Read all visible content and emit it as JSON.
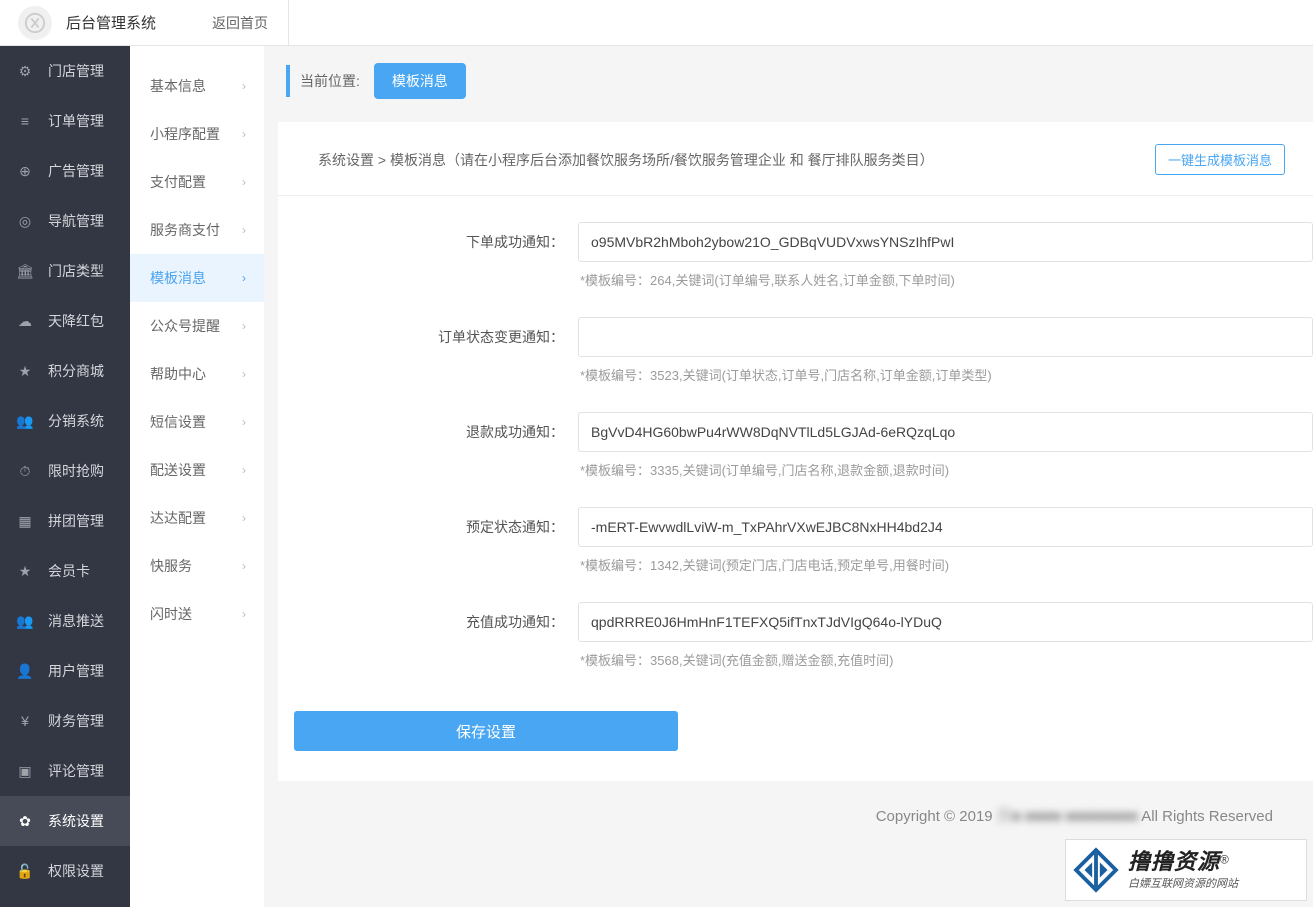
{
  "header": {
    "system_title": "后台管理系统",
    "back_home": "返回首页"
  },
  "primary_nav": [
    {
      "label": "门店管理",
      "icon": "dashboard"
    },
    {
      "label": "订单管理",
      "icon": "list"
    },
    {
      "label": "广告管理",
      "icon": "globe"
    },
    {
      "label": "导航管理",
      "icon": "target"
    },
    {
      "label": "门店类型",
      "icon": "bank"
    },
    {
      "label": "天降红包",
      "icon": "cloud"
    },
    {
      "label": "积分商城",
      "icon": "star"
    },
    {
      "label": "分销系统",
      "icon": "users"
    },
    {
      "label": "限时抢购",
      "icon": "clock"
    },
    {
      "label": "拼团管理",
      "icon": "grid"
    },
    {
      "label": "会员卡",
      "icon": "star"
    },
    {
      "label": "消息推送",
      "icon": "users"
    },
    {
      "label": "用户管理",
      "icon": "user"
    },
    {
      "label": "财务管理",
      "icon": "yen"
    },
    {
      "label": "评论管理",
      "icon": "comment"
    },
    {
      "label": "系统设置",
      "icon": "gear",
      "active": true
    },
    {
      "label": "权限设置",
      "icon": "lock"
    }
  ],
  "secondary_nav": [
    {
      "label": "基本信息"
    },
    {
      "label": "小程序配置"
    },
    {
      "label": "支付配置"
    },
    {
      "label": "服务商支付"
    },
    {
      "label": "模板消息",
      "active": true
    },
    {
      "label": "公众号提醒"
    },
    {
      "label": "帮助中心"
    },
    {
      "label": "短信设置"
    },
    {
      "label": "配送设置"
    },
    {
      "label": "达达配置"
    },
    {
      "label": "快服务"
    },
    {
      "label": "闪时送"
    }
  ],
  "breadcrumb": {
    "label": "当前位置:",
    "badge": "模板消息"
  },
  "panel": {
    "path": "系统设置 > 模板消息（请在小程序后台添加餐饮服务场所/餐饮服务管理企业 和 餐厅排队服务类目）",
    "generate_button": "一键生成模板消息"
  },
  "form": {
    "rows": [
      {
        "label": "下单成功通知：",
        "value": "o95MVbR2hMboh2ybow21O_GDBqVUDVxwsYNSzIhfPwI",
        "hint": "*模板编号：264,关键词(订单编号,联系人姓名,订单金额,下单时间)"
      },
      {
        "label": "订单状态变更通知：",
        "value": "",
        "hint": "*模板编号：3523,关键词(订单状态,订单号,门店名称,订单金额,订单类型)"
      },
      {
        "label": "退款成功通知：",
        "value": "BgVvD4HG60bwPu4rWW8DqNVTlLd5LGJAd-6eRQzqLqo",
        "hint": "*模板编号：3335,关键词(订单编号,门店名称,退款金额,退款时间)"
      },
      {
        "label": "预定状态通知：",
        "value": "-mERT-EwvwdlLviW-m_TxPAhrVXwEJBC8NxHH4bd2J4",
        "hint": "*模板编号：1342,关键词(预定门店,门店电话,预定单号,用餐时间)"
      },
      {
        "label": "充值成功通知：",
        "value": "qpdRRRE0J6HmHnF1TEFXQ5ifTnxTJdVIgQ64o-lYDuQ",
        "hint": "*模板编号：3568,关键词(充值金额,赠送金额,充值时间)"
      }
    ],
    "save_label": "保存设置"
  },
  "footer": {
    "prefix": "Copyright © 2019 ",
    "blurred": "贝■ ■■■■ ■■■■■■■■",
    "suffix": " All Rights Reserved"
  },
  "watermark": {
    "main": "撸撸资源",
    "reg": "®",
    "sub": "白嫖互联网资源的网站"
  },
  "icons": {
    "dashboard": "⚙",
    "list": "≡",
    "globe": "⊕",
    "target": "◎",
    "bank": "🏛",
    "cloud": "☁",
    "star": "★",
    "users": "👥",
    "clock": "⏱",
    "grid": "▦",
    "user": "👤",
    "yen": "¥",
    "comment": "▣",
    "gear": "✿",
    "lock": "🔓"
  }
}
